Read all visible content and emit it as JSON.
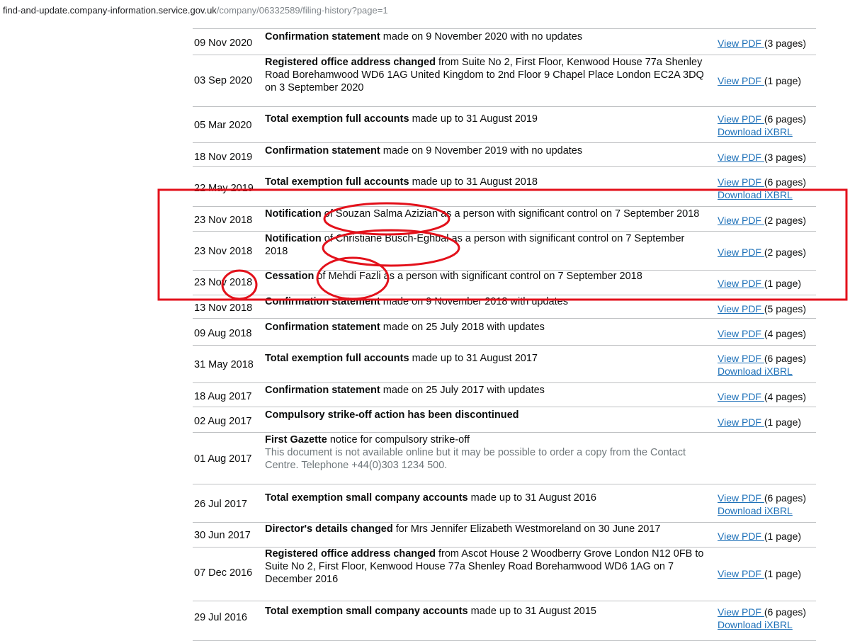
{
  "browser": {
    "url_host": "find-and-update.company-information.service.gov.uk",
    "url_path": "/company/06332589/filing-history?page=1"
  },
  "view_pdf_label": "View PDF",
  "ixbrl_label": "Download iXBRL",
  "filings": [
    {
      "date": "09 Nov 2020",
      "bold": "Confirmation statement",
      "rest": " made on 9 November 2020 with no updates",
      "pages": "(3 pages)",
      "ixbrl": false
    },
    {
      "date": "03 Sep 2020",
      "bold": "Registered office address changed",
      "rest": " from Suite No 2, First Floor, Kenwood House 77a Shenley Road Borehamwood WD6 1AG United Kingdom to 2nd Floor 9 Chapel Place London EC2A 3DQ on 3 September 2020",
      "pages": "(1 page)",
      "ixbrl": false
    },
    {
      "date": "05 Mar 2020",
      "bold": "Total exemption full accounts",
      "rest": " made up to 31 August 2019",
      "pages": "(6 pages)",
      "ixbrl": true
    },
    {
      "date": "18 Nov 2019",
      "bold": "Confirmation statement",
      "rest": " made on 9 November 2019 with no updates",
      "pages": "(3 pages)",
      "ixbrl": false
    },
    {
      "date": "22 May 2019",
      "bold": "Total exemption full accounts",
      "rest": " made up to 31 August 2018",
      "pages": "(6 pages)",
      "ixbrl": true
    },
    {
      "date": "23 Nov 2018",
      "bold": "Notification",
      "rest": " of Souzan Salma Azizian as a person with significant control on 7 September 2018",
      "pages": "(2 pages)",
      "ixbrl": false
    },
    {
      "date": "23 Nov 2018",
      "bold": "Notification",
      "rest": " of Christiane Busch-Eghbal as a person with significant control on 7 September 2018",
      "pages": "(2 pages)",
      "ixbrl": false
    },
    {
      "date": "23 Nov 2018",
      "bold": "Cessation",
      "rest": " of Mehdi Fazli as a person with significant control on 7 September 2018",
      "pages": "(1 page)",
      "ixbrl": false
    },
    {
      "date": "13 Nov 2018",
      "bold": "Confirmation statement",
      "rest": " made on 9 November 2018 with updates",
      "pages": "(5 pages)",
      "ixbrl": false
    },
    {
      "date": "09 Aug 2018",
      "bold": "Confirmation statement",
      "rest": " made on 25 July 2018 with updates",
      "pages": "(4 pages)",
      "ixbrl": false
    },
    {
      "date": "31 May 2018",
      "bold": "Total exemption full accounts",
      "rest": " made up to 31 August 2017",
      "pages": "(6 pages)",
      "ixbrl": true
    },
    {
      "date": "18 Aug 2017",
      "bold": "Confirmation statement",
      "rest": " made on 25 July 2017 with updates",
      "pages": "(4 pages)",
      "ixbrl": false
    },
    {
      "date": "02 Aug 2017",
      "bold": "Compulsory strike-off action has been discontinued",
      "rest": "",
      "pages": "(1 page)",
      "ixbrl": false
    },
    {
      "date": "01 Aug 2017",
      "bold": "First Gazette",
      "rest": " notice for compulsory strike-off",
      "note": "This document is not available online but it may be possible to order a copy from the Contact Centre. Telephone +44(0)303 1234 500.",
      "pages": "",
      "ixbrl": false,
      "nopdf": true
    },
    {
      "date": "26 Jul 2017",
      "bold": "Total exemption small company accounts",
      "rest": " made up to 31 August 2016",
      "pages": "(6 pages)",
      "ixbrl": true
    },
    {
      "date": "30 Jun 2017",
      "bold": "Director's details changed",
      "rest": " for Mrs Jennifer Elizabeth Westmoreland on 30 June 2017",
      "pages": "(1 page)",
      "ixbrl": false
    },
    {
      "date": "07 Dec 2016",
      "bold": "Registered office address changed",
      "rest": " from Ascot House 2 Woodberry Grove London N12 0FB to Suite No 2, First Floor, Kenwood House 77a Shenley Road Borehamwood WD6 1AG on 7 December 2016",
      "pages": "(1 page)",
      "ixbrl": false
    },
    {
      "date": "29 Jul 2016",
      "bold": "Total exemption small company accounts",
      "rest": " made up to 31 August 2015",
      "pages": "(6 pages)",
      "ixbrl": true
    }
  ],
  "annotation_color": "#e3111b"
}
